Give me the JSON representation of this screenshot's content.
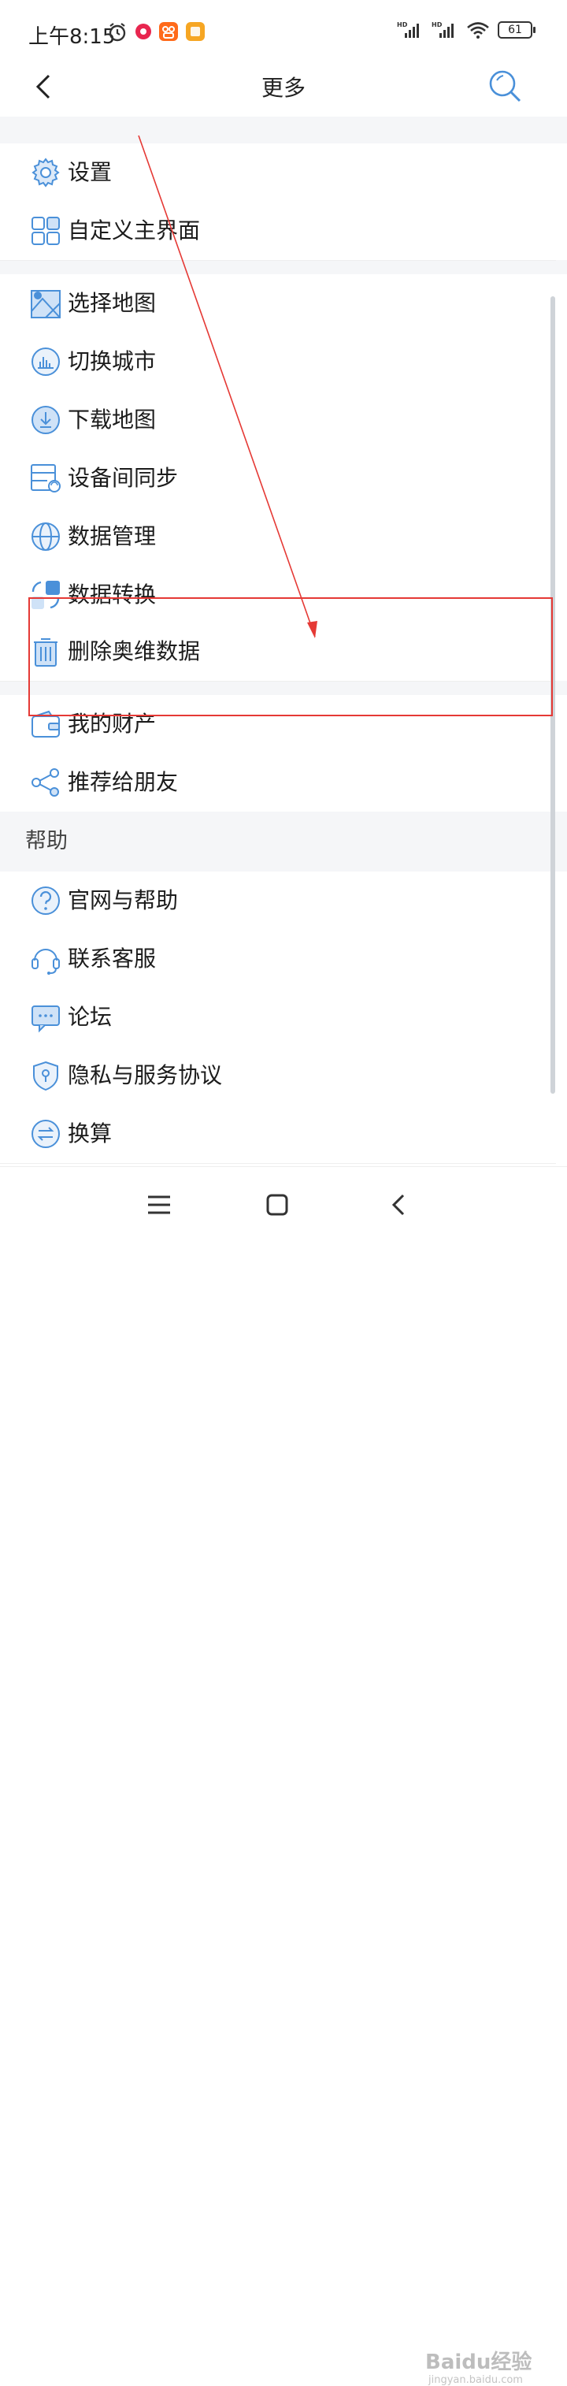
{
  "status_bar": {
    "time": "上午8:15",
    "network_labels": [
      "HD",
      "HD"
    ],
    "battery": "61"
  },
  "header": {
    "title": "更多",
    "back_icon": "chevron-left-icon",
    "search_icon": "search-icon"
  },
  "groups": [
    {
      "items": [
        {
          "label": "设置",
          "icon": "gear-icon"
        },
        {
          "label": "自定义主界面",
          "icon": "grid-icon"
        }
      ]
    },
    {
      "items": [
        {
          "label": "选择地图",
          "icon": "map-icon"
        },
        {
          "label": "切换城市",
          "icon": "city-icon"
        },
        {
          "label": "下载地图",
          "icon": "download-icon"
        },
        {
          "label": "设备间同步",
          "icon": "sync-icon"
        },
        {
          "label": "数据管理",
          "icon": "globe-icon"
        },
        {
          "label": "数据转换",
          "icon": "convert-icon"
        },
        {
          "label": "删除奥维数据",
          "icon": "trash-icon"
        }
      ]
    },
    {
      "items": [
        {
          "label": "我的财产",
          "icon": "wallet-icon"
        },
        {
          "label": "推荐给朋友",
          "icon": "share-icon"
        }
      ]
    }
  ],
  "help_section": {
    "header": "帮助",
    "items": [
      {
        "label": "官网与帮助",
        "icon": "help-icon"
      },
      {
        "label": "联系客服",
        "icon": "headset-icon"
      },
      {
        "label": "论坛",
        "icon": "chat-icon"
      },
      {
        "label": "隐私与服务协议",
        "icon": "shield-icon"
      },
      {
        "label": "换算",
        "icon": "exchange-icon"
      }
    ]
  },
  "watermark": {
    "text": "Baidu经验",
    "sub": "jingyan.baidu.com"
  },
  "colors": {
    "icon_blue": "#4a90d9",
    "annotation_red": "#e53935",
    "section_bg": "#f5f6f8"
  }
}
